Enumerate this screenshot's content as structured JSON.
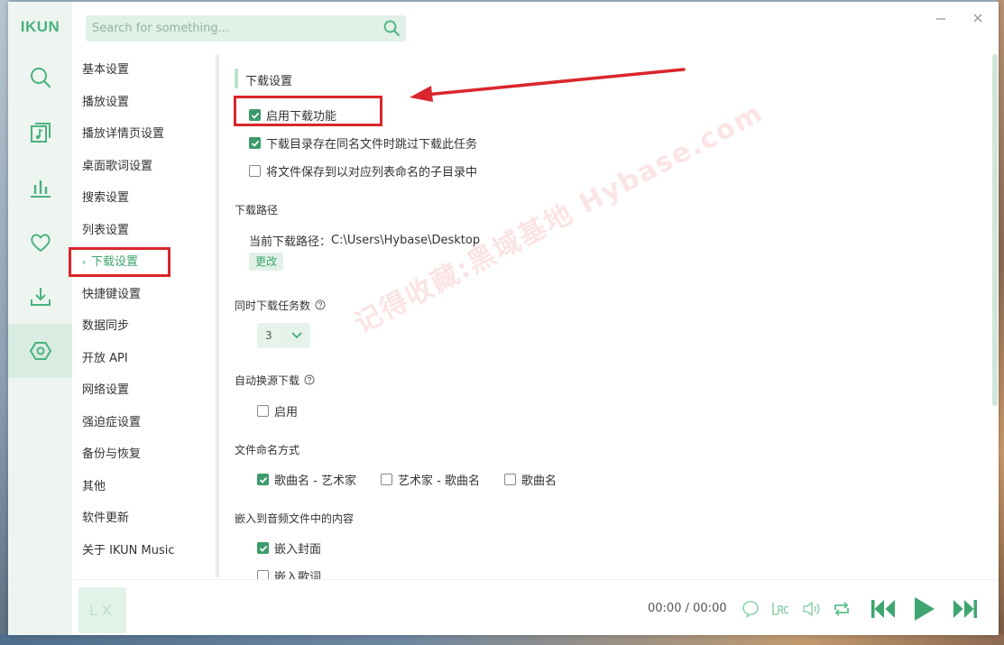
{
  "app": {
    "logo": "IKUN"
  },
  "search": {
    "placeholder": "Search for something..."
  },
  "rail": [
    "search-icon",
    "music-library-icon",
    "chart-icon",
    "heart-icon",
    "download-icon",
    "settings-icon"
  ],
  "nav": {
    "items": [
      "基本设置",
      "播放设置",
      "播放详情页设置",
      "桌面歌词设置",
      "搜索设置",
      "列表设置",
      "下载设置",
      "快捷键设置",
      "数据同步",
      "开放 API",
      "网络设置",
      "强迫症设置",
      "备份与恢复",
      "其他",
      "软件更新",
      "关于 IKUN Music"
    ],
    "active_chevron": "›",
    "active_index": 6
  },
  "content": {
    "section_title": "下载设置",
    "enable_download": "启用下载功能",
    "skip_existing": "下载目录存在同名文件时跳过下载此任务",
    "save_to_subdir": "将文件保存到以对应列表命名的子目录中",
    "path_title": "下载路径",
    "current_path_label": "当前下载路径：",
    "current_path": "C:\\Users\\Hybase\\Desktop",
    "change_button": "更改",
    "concurrent_title": "同时下载任务数",
    "concurrent_value": "3",
    "auto_switch_title": "自动换源下载",
    "auto_switch_enable": "启用",
    "naming_title": "文件命名方式",
    "naming_options": [
      "歌曲名 - 艺术家",
      "艺术家 - 歌曲名",
      "歌曲名"
    ],
    "embed_title": "嵌入到音频文件中的内容",
    "embed_cover": "嵌入封面",
    "embed_lyrics": "嵌入歌词"
  },
  "watermark": "记得收藏:黑域基地 Hybase.com",
  "player": {
    "album_placeholder": "LX",
    "current_time": "00:00",
    "separator": "/",
    "total_time": "00:00"
  },
  "colors": {
    "accent": "#3fa56f",
    "highlight": "#d9262c"
  }
}
